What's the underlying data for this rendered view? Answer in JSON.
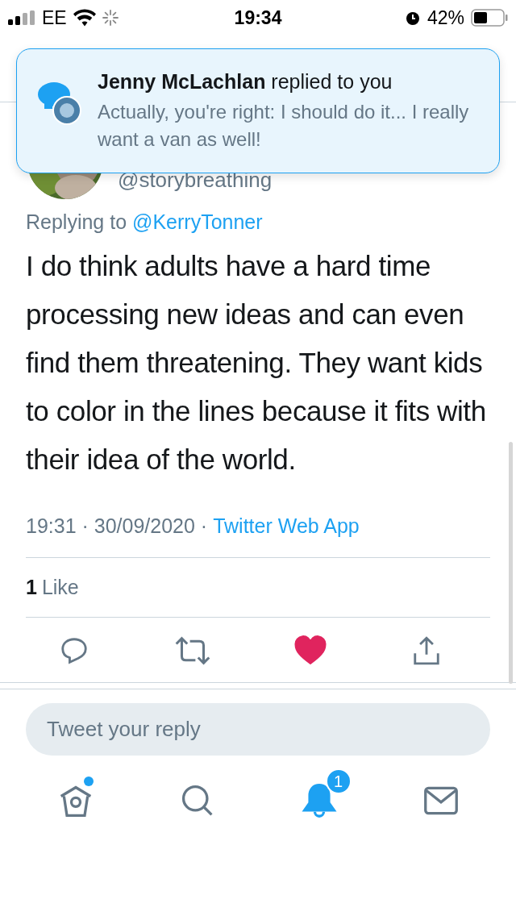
{
  "status_bar": {
    "carrier": "EE",
    "time": "19:34",
    "battery": "42%"
  },
  "notification": {
    "text": "**Jenny McLachlan** replied to you",
    "preview": "Actually, you're right: I should do it... I really want a van as well!"
  },
  "tweet": {
    "handle": "@storybreathing",
    "replying_prefix": "Replying to",
    "reply_to": "@KerryTonner",
    "text": "I do think adults have a hard time processing new ideas and can even find them threatening. They want kids to color in the lines because it fits with their idea of the world.",
    "timestamp": "19:31 · 30/09/2020 ·",
    "source": "Twitter Web App",
    "like_count": "1",
    "like_label": "Like"
  },
  "actions": [
    {
      "kind": "reply"
    },
    {
      "kind": "retweet"
    },
    {
      "kind": "like",
      "active": true
    },
    {
      "kind": "share"
    }
  ],
  "reply_field": {
    "placeholder": "Tweet your reply"
  },
  "tabs": [
    {
      "kind": "home",
      "selected": false,
      "new": true
    },
    {
      "kind": "search",
      "selected": false
    },
    {
      "kind": "notifications",
      "selected": true,
      "badge": "1"
    },
    {
      "kind": "messages",
      "selected": false
    }
  ]
}
